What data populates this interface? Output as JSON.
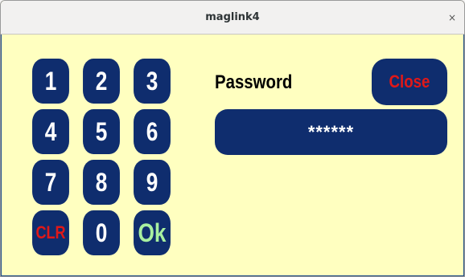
{
  "window": {
    "title": "maglink4",
    "close_glyph": "×"
  },
  "keypad": {
    "keys": [
      {
        "label": "1"
      },
      {
        "label": "2"
      },
      {
        "label": "3"
      },
      {
        "label": "4"
      },
      {
        "label": "5"
      },
      {
        "label": "6"
      },
      {
        "label": "7"
      },
      {
        "label": "8"
      },
      {
        "label": "9"
      },
      {
        "label": "CLR"
      },
      {
        "label": "0"
      },
      {
        "label": "Ok"
      }
    ]
  },
  "password": {
    "label": "Password",
    "value": "******"
  },
  "close_button": {
    "label": "Close"
  },
  "colors": {
    "background": "#ffffc0",
    "button": "#0f2d6e",
    "button_text": "#ffffff",
    "clr_text": "#e01818",
    "ok_text": "#a8f0a0",
    "close_text": "#e01818"
  }
}
